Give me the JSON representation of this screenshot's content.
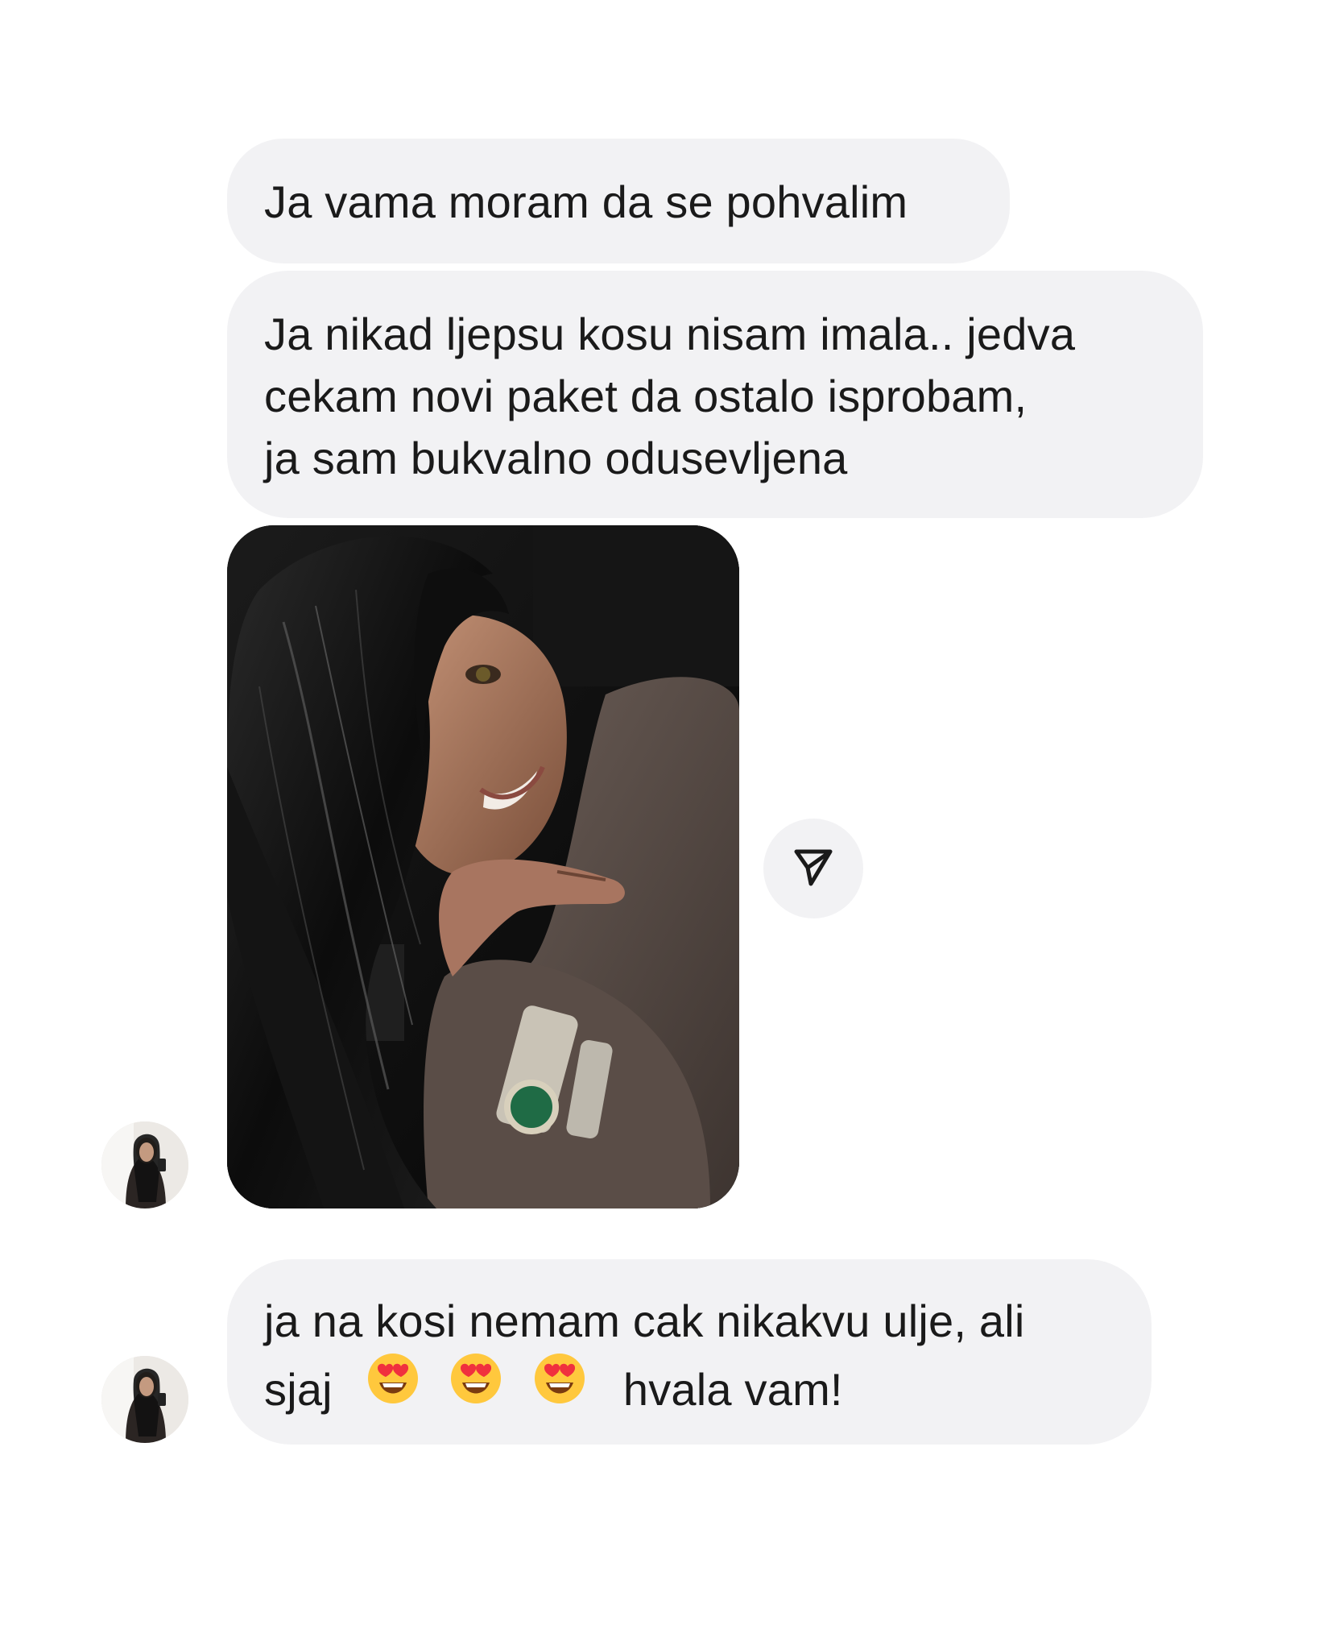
{
  "messages": [
    {
      "type": "text",
      "lines": [
        "Ja vama moram da se pohvalim"
      ]
    },
    {
      "type": "text",
      "lines": [
        "Ja nikad ljepsu kosu nisam imala.. jedva",
        "cekam novi paket da ostalo isprobam,",
        "ja sam bukvalno odusevljena"
      ]
    },
    {
      "type": "image",
      "description_icon": "photo-attachment"
    },
    {
      "type": "text",
      "lines": [
        "ja na kosi nemam cak nikakvu ulje, ali"
      ],
      "emoji_line_prefix": "sjaj",
      "emojis": [
        "heart-eyes-emoji",
        "heart-eyes-emoji",
        "heart-eyes-emoji"
      ],
      "emoji_line_suffix": "hvala vam!"
    }
  ],
  "icons": {
    "share": "send-paper-plane-icon",
    "avatar": "user-avatar"
  },
  "colors": {
    "bubble_bg": "#f2f2f4",
    "text": "#1a1a1a",
    "background": "#ffffff"
  }
}
